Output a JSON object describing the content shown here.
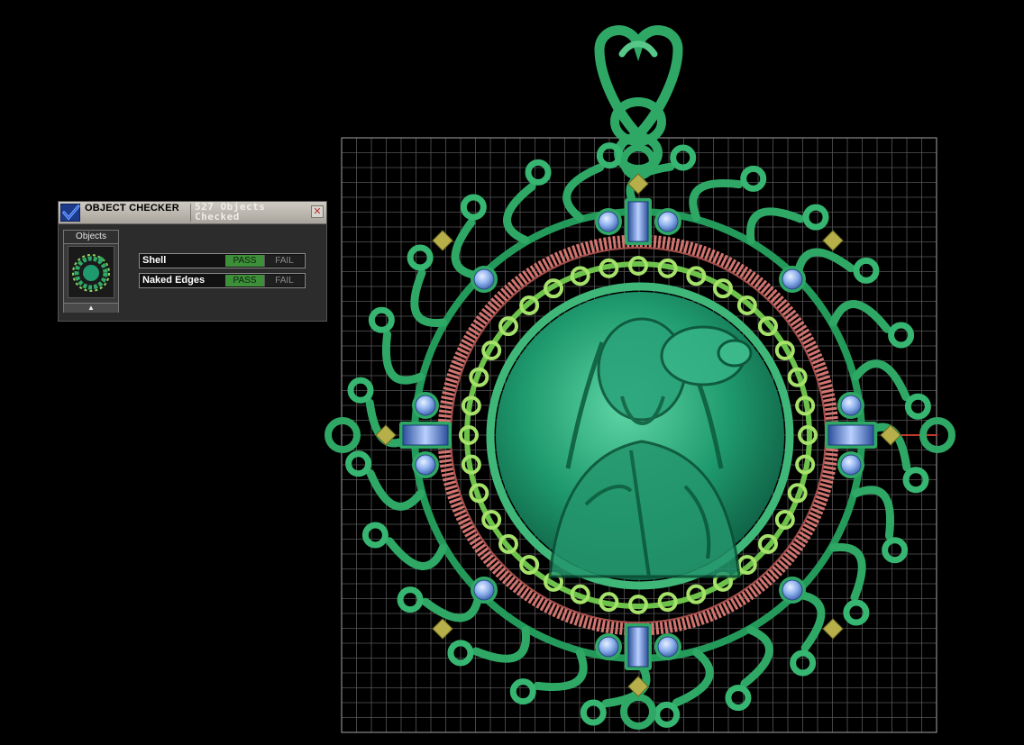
{
  "panel": {
    "title": "OBJECT CHECKER",
    "count_line1": "527 Objects",
    "count_line2": "Checked",
    "close_symbol": "✕",
    "objects_label": "Objects",
    "scroll_symbol": "▲"
  },
  "checks": [
    {
      "label": "Shell",
      "pass": "PASS",
      "fail": "FAIL",
      "result": "pass"
    },
    {
      "label": "Naked Edges",
      "pass": "PASS",
      "fail": "FAIL",
      "result": "pass"
    }
  ],
  "icons": {
    "checker": "checkmark-icon",
    "close": "close-icon",
    "scroll": "scroll-up-icon",
    "thumbnail": "pendant-thumbnail-icon"
  },
  "colors": {
    "background": "#000000",
    "grid": "#5a5a5a",
    "metal_green": "#2fa866",
    "light_green": "#8fd35a",
    "rope_pink": "#d2746f",
    "gem_blue": "#8fb2ee",
    "gold": "#b7b04a",
    "pass_green": "#3e8f3a"
  }
}
